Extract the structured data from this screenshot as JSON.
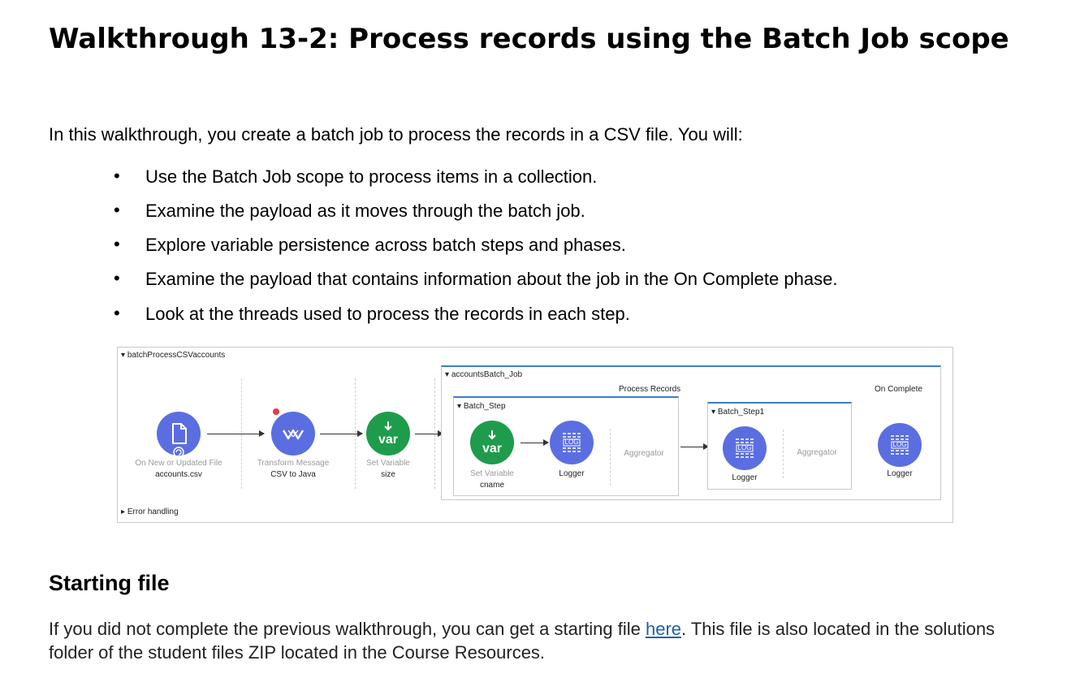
{
  "title": "Walkthrough 13-2: Process records using the Batch Job scope",
  "intro": "In this walkthrough, you create a batch job to process the records in a CSV file. You will:",
  "objectives": [
    "Use the Batch Job scope to process items in a collection.",
    "Examine the payload as it moves through the batch job.",
    "Explore variable persistence across batch steps and phases.",
    "Examine the payload that contains information about the job in the On Complete phase.",
    "Look at the threads used to process the records in each step."
  ],
  "flow": {
    "flow_name": "batchProcessCSVaccounts",
    "error_handling": "Error handling",
    "source": {
      "type": "On New or Updated File",
      "name": "accounts.csv"
    },
    "transform": {
      "type": "Transform Message",
      "name": "CSV to Java"
    },
    "set_variable_size": {
      "type": "Set Variable",
      "name": "size"
    },
    "batch_job": {
      "name": "accountsBatch_Job",
      "process_records_label": "Process Records",
      "on_complete_label": "On Complete",
      "step1": {
        "name": "Batch_Step",
        "set_variable": {
          "type": "Set Variable",
          "name": "cname"
        },
        "logger": "Logger",
        "aggregator": "Aggregator"
      },
      "step2": {
        "name": "Batch_Step1",
        "logger": "Logger",
        "aggregator": "Aggregator"
      },
      "on_complete_logger": "Logger"
    },
    "var_glyph": "var",
    "log_glyph": "LOG",
    "colors": {
      "connector": "#5b6ee1",
      "variable": "#1e9c4b",
      "scope_border": "#3d7cc9",
      "breakpoint": "#e63946"
    }
  },
  "starting_file": {
    "heading": "Starting file",
    "text_before": "If you did not complete the previous walkthrough, you can get a starting file ",
    "link_text": "here",
    "text_after": ". This file is also located in the solutions folder of the student files ZIP located in the Course Resources."
  }
}
